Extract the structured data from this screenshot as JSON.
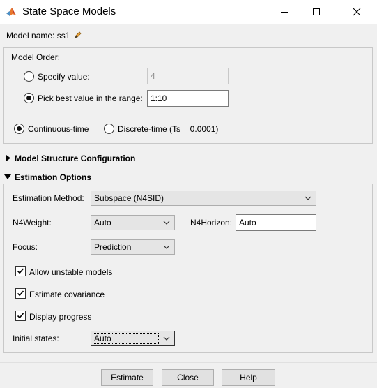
{
  "window": {
    "title": "State Space Models",
    "app_icon": "matlab-logo-icon",
    "controls": [
      "minimize-icon",
      "maximize-icon",
      "close-icon"
    ]
  },
  "model_name": {
    "label": "Model name: ss1",
    "edit_icon": "pencil-icon"
  },
  "model_order": {
    "title": "Model Order:",
    "specify_label": "Specify value:",
    "specify_value": "4",
    "specify_checked": false,
    "range_label": "Pick best value in the range:",
    "range_value": "1:10",
    "range_checked": true,
    "continuous_label": "Continuous-time",
    "continuous_checked": true,
    "discrete_label": "Discrete-time (Ts = 0.0001)",
    "discrete_checked": false
  },
  "structure": {
    "label": "Model Structure Configuration",
    "expanded": false
  },
  "estimation": {
    "label": "Estimation Options",
    "expanded": true,
    "method_label": "Estimation Method:",
    "method_value": "Subspace (N4SID)",
    "n4weight_label": "N4Weight:",
    "n4weight_value": "Auto",
    "n4horizon_label": "N4Horizon:",
    "n4horizon_value": "Auto",
    "focus_label": "Focus:",
    "focus_value": "Prediction",
    "unstable_label": "Allow unstable models",
    "unstable_checked": true,
    "covariance_label": "Estimate covariance",
    "covariance_checked": true,
    "progress_label": "Display progress",
    "progress_checked": true,
    "initial_label": "Initial states:",
    "initial_value": "Auto"
  },
  "buttons": {
    "estimate": "Estimate",
    "close": "Close",
    "help": "Help"
  }
}
